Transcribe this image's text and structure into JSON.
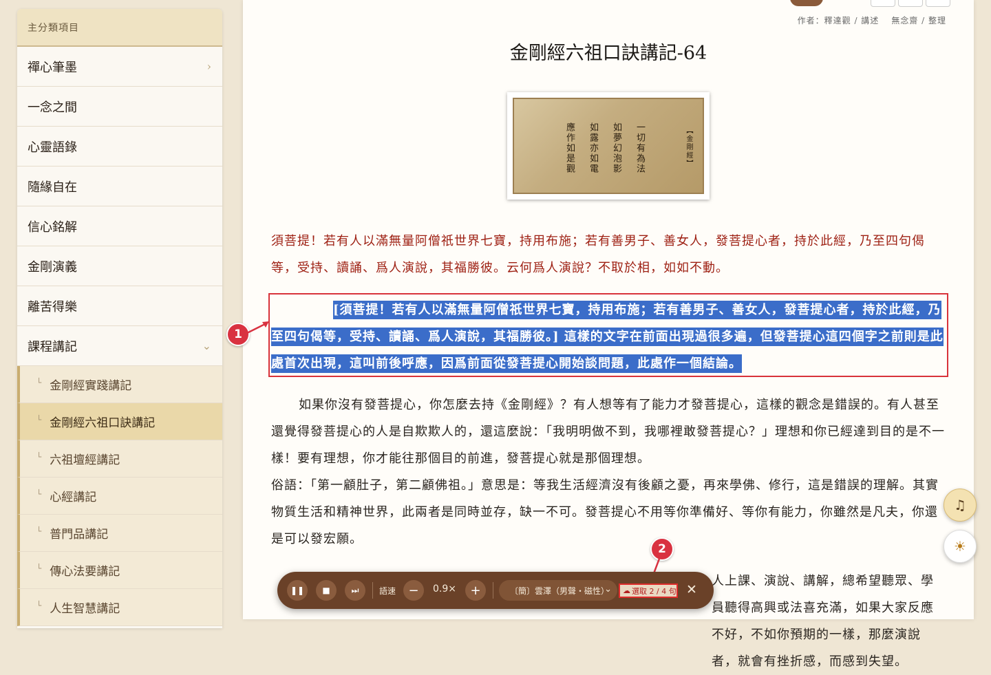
{
  "sidebar": {
    "header": "主分類項目",
    "items": [
      {
        "label": "禪心筆墨",
        "chevron": "›"
      },
      {
        "label": "一念之間"
      },
      {
        "label": "心靈語錄"
      },
      {
        "label": "隨緣自在"
      },
      {
        "label": "信心銘解"
      },
      {
        "label": "金剛演義"
      },
      {
        "label": "離苦得樂"
      },
      {
        "label": "課程講記",
        "chevron": "⌄"
      }
    ],
    "subitems": [
      {
        "label": "金剛經實踐講記"
      },
      {
        "label": "金剛經六祖口訣講記",
        "active": true
      },
      {
        "label": "六祖壇經講記"
      },
      {
        "label": "心經講記"
      },
      {
        "label": "普門品講記"
      },
      {
        "label": "傳心法要講記"
      },
      {
        "label": "人生智慧講記"
      }
    ]
  },
  "article": {
    "author": "作者：釋達觀 / 講述",
    "editor": "無念齋 / 整理",
    "title": "金剛經六祖口訣講記-64",
    "image_columns": [
      "【金剛經】",
      "一切有為法",
      "如夢幻泡影",
      "如露亦如電",
      "應作如是觀"
    ],
    "sutra_quote": "須菩提！若有人以滿無量阿僧祇世界七寶，持用布施；若有善男子、善女人，發菩提心者，持於此經，乃至四句偈等，受持、讀誦、爲人演說，其福勝彼。云何爲人演說？不取於相，如如不動。",
    "highlighted": "[須菩提！若有人以滿無量阿僧祇世界七寶，持用布施；若有善男子、善女人，發菩提心者，持於此經，乃至四句偈等，受持、讀誦、爲人演說，其福勝彼。] 這樣的文字在前面出現過很多遍，但發菩提心這四個字之前則是此處首次出現，這叫前後呼應，因爲前面從發菩提心開始談問題，此處作一個結論。",
    "p1": "如果你沒有發菩提心，你怎麼去持《金剛經》？有人想等有了能力才發菩提心，這樣的觀念是錯誤的。有人甚至還覺得發菩提心的人是自欺欺人的，還這麼說：「我明明做不到，我哪裡敢發菩提心？」理想和你已經達到目的是不一樣！要有理想，你才能往那個目的前進，發菩提心就是那個理想。",
    "p2": "俗語：「第一顧肚子，第二顧佛祖。」意思是：等我生活經濟沒有後顧之憂，再來學佛、修行，這是錯誤的理解。其實物質生活和精神世界，此兩者是同時並存，缺一不可。發菩提心不用等你準備好、等你有能力，你雖然是凡夫，你還是可以發宏願。",
    "p3": "人上課、演說、講解，總希望聽眾、學員聽得高興或法喜充滿，如果大家反應不好，不如你預期的一樣，那麼演說者，就會有挫折感，而感到失望。"
  },
  "markers": {
    "m1": "1",
    "m2": "2"
  },
  "tts": {
    "speed_label": "語速",
    "rate": "0.9×",
    "voice": "〔簡〕雲澤（男聲・磁性）",
    "selection": "選取 2 / 4 句",
    "minus": "−",
    "plus": "+",
    "close": "✕"
  },
  "colors": {
    "accent_brown": "#6a4128",
    "highlight_blue": "#3b6dc9",
    "quote_red": "#9d1f12",
    "callout_red": "#d93240"
  }
}
